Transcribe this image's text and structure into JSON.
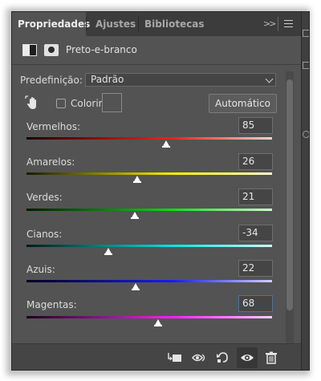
{
  "tabs": [
    {
      "label": "Propriedades",
      "active": true
    },
    {
      "label": "Ajustes",
      "active": false
    },
    {
      "label": "Bibliotecas",
      "active": false
    }
  ],
  "tabbar": {
    "collapse_icon": "double-chevron-right-icon",
    "menu_icon": "hamburger-menu-icon"
  },
  "header": {
    "title": "Preto-e-branco",
    "layer_icon": "black-white-adjustment-icon",
    "mask_icon": "layer-mask-icon"
  },
  "preset": {
    "label": "Predefinição:",
    "value": "Padrão"
  },
  "tint": {
    "label": "Colorir",
    "checked": false,
    "swatch_color": "#535353",
    "auto_label": "Automático"
  },
  "sliders": [
    {
      "label": "Vermelhos:",
      "value": "85",
      "min": -200,
      "max": 300,
      "gradient": [
        "#1a0000",
        "#ff1e1e",
        "#ffd0d0"
      ]
    },
    {
      "label": "Amarelos:",
      "value": "26",
      "min": -200,
      "max": 300,
      "gradient": [
        "#1a1a00",
        "#ffee00",
        "#fffbd0"
      ]
    },
    {
      "label": "Verdes:",
      "value": "21",
      "min": -200,
      "max": 300,
      "gradient": [
        "#001a00",
        "#11dd11",
        "#d0ffd0"
      ]
    },
    {
      "label": "Cianos:",
      "value": "-34",
      "min": -200,
      "max": 300,
      "gradient": [
        "#001a1a",
        "#00e6e6",
        "#d0ffff"
      ]
    },
    {
      "label": "Azuis:",
      "value": "22",
      "min": -200,
      "max": 300,
      "gradient": [
        "#00001a",
        "#1a1aff",
        "#d0d0ff"
      ]
    },
    {
      "label": "Magentas:",
      "value": "68",
      "min": -200,
      "max": 300,
      "gradient": [
        "#1a001a",
        "#ff1eff",
        "#ffd0ff"
      ],
      "focused": true
    }
  ],
  "bottom_toolbar": [
    {
      "name": "clip-to-layer-icon"
    },
    {
      "name": "view-previous-state-icon"
    },
    {
      "name": "reset-icon"
    },
    {
      "name": "visibility-eye-icon",
      "active": true
    },
    {
      "name": "trash-icon"
    }
  ],
  "colors": {
    "panel_bg": "#535353",
    "tab_bar_bg": "#3c3c3c",
    "focus_blue": "#2f79c8"
  }
}
